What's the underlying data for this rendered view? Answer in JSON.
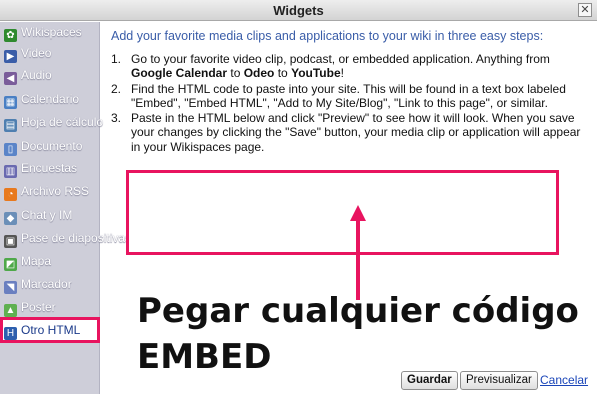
{
  "window": {
    "title": "Widgets",
    "close_label": "✕"
  },
  "sidebar": {
    "items": [
      {
        "label": "Wikispaces",
        "icon": "wikispaces-icon",
        "color": "#2f8a2f",
        "glyph": "✿"
      },
      {
        "label": "Video",
        "icon": "video-icon",
        "color": "#3a5da8",
        "glyph": "▶"
      },
      {
        "label": "Audio",
        "icon": "speaker-icon",
        "color": "#7a5c9a",
        "glyph": "◀"
      },
      {
        "label": "Calendario",
        "icon": "calendar-icon",
        "color": "#4a7fc4",
        "glyph": "▦"
      },
      {
        "label": "Hoja de cálculo",
        "icon": "spreadsheet-icon",
        "color": "#4f7fb0",
        "glyph": "▤"
      },
      {
        "label": "Documento",
        "icon": "document-icon",
        "color": "#5a84c8",
        "glyph": "▯"
      },
      {
        "label": "Encuestas",
        "icon": "poll-icon",
        "color": "#6a6ab0",
        "glyph": "▥"
      },
      {
        "label": "Archivo RSS",
        "icon": "rss-icon",
        "color": "#e8791e",
        "glyph": "◔"
      },
      {
        "label": "Chat y IM",
        "icon": "chat-icon",
        "color": "#6b8fb8",
        "glyph": "◆"
      },
      {
        "label": "Pase de diapositivas",
        "icon": "slideshow-icon",
        "color": "#555",
        "glyph": "▣"
      },
      {
        "label": "Mapa",
        "icon": "map-icon",
        "color": "#4fa84a",
        "glyph": "◩"
      },
      {
        "label": "Marcador",
        "icon": "bookmark-tag-icon",
        "color": "#6a7fc0",
        "glyph": "◥"
      },
      {
        "label": "Poster",
        "icon": "poster-icon",
        "color": "#5fb050",
        "glyph": "▲"
      },
      {
        "label": "Otro HTML",
        "icon": "html-icon",
        "color": "#2d5fae",
        "glyph": "H"
      }
    ]
  },
  "content": {
    "intro": "Add your favorite media clips and applications to your wiki in three easy steps:",
    "step1_num": "1.",
    "step1_a": "Go to your favorite video clip, podcast, or embedded application. Anything from ",
    "step1_b": "Google Calendar",
    "step1_c": " to ",
    "step1_d": "Odeo",
    "step1_e": " to ",
    "step1_f": "YouTube",
    "step1_g": "!",
    "step2_num": "2.",
    "step2": "Find the HTML code to paste into your site. This will be found in a text box labeled \"Embed\", \"Embed HTML\", \"Add to My Site/Blog\", \"Link to this page\", or similar.",
    "step3_num": "3.",
    "step3": "Paste in the HTML below and click \"Preview\" to see how it will look. When you save your changes by clicking the \"Save\" button, your media clip or application will appear in your Wikispaces page.",
    "embed_value": ""
  },
  "annotation": {
    "line1": "Pegar cualquier código",
    "line2": "EMBED",
    "color": "#e8145f"
  },
  "footer": {
    "save_label": "Guardar",
    "preview_label": "Previsualizar",
    "cancel_label": "Cancelar"
  }
}
